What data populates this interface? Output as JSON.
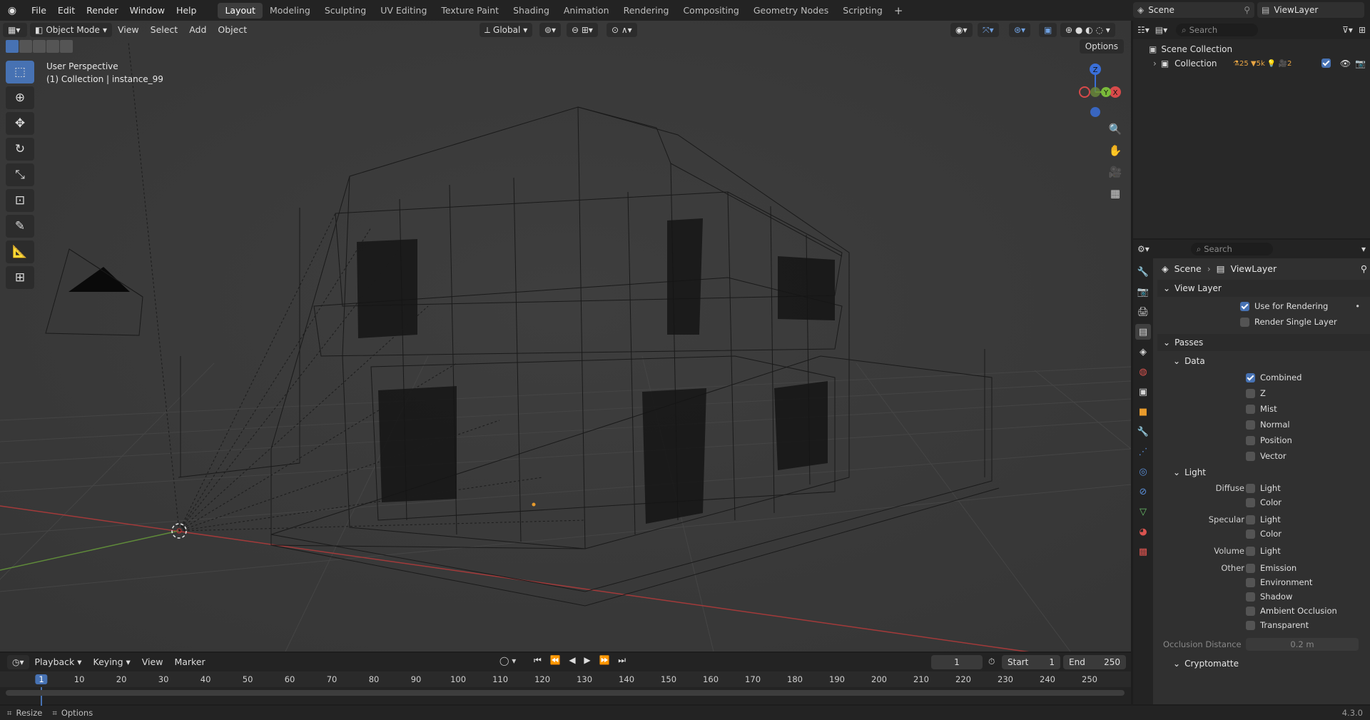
{
  "menubar": {
    "items": [
      "File",
      "Edit",
      "Render",
      "Window",
      "Help"
    ],
    "workspaces": [
      "Layout",
      "Modeling",
      "Sculpting",
      "UV Editing",
      "Texture Paint",
      "Shading",
      "Animation",
      "Rendering",
      "Compositing",
      "Geometry Nodes",
      "Scripting"
    ],
    "active_workspace": "Layout",
    "scene_name": "Scene",
    "view_layer_name": "ViewLayer"
  },
  "viewport": {
    "mode": "Object Mode",
    "menus": [
      "View",
      "Select",
      "Add",
      "Object"
    ],
    "transform_orientation": "Global",
    "options_label": "Options",
    "info_line1": "User Perspective",
    "info_line2": "(1) Collection | instance_99",
    "gizmo": {
      "z": "Z",
      "y": "Y",
      "x": "X"
    }
  },
  "outliner": {
    "search_placeholder": "Search",
    "scene_collection": "Scene Collection",
    "collection": "Collection",
    "collection_badges": [
      "25",
      "5k",
      "2"
    ]
  },
  "properties": {
    "search_placeholder": "Search",
    "breadcrumb_scene": "Scene",
    "breadcrumb_viewlayer": "ViewLayer",
    "view_layer_panel": "View Layer",
    "use_for_rendering": "Use for Rendering",
    "render_single_layer": "Render Single Layer",
    "passes_panel": "Passes",
    "data_sub": "Data",
    "data_passes": [
      {
        "label": "Combined",
        "on": true
      },
      {
        "label": "Z",
        "on": false
      },
      {
        "label": "Mist",
        "on": false
      },
      {
        "label": "Normal",
        "on": false
      },
      {
        "label": "Position",
        "on": false
      },
      {
        "label": "Vector",
        "on": false
      }
    ],
    "light_sub": "Light",
    "diffuse_label": "Diffuse",
    "specular_label": "Specular",
    "volume_label": "Volume",
    "other_label": "Other",
    "light_pass_light": "Light",
    "light_pass_color": "Color",
    "other_passes": [
      "Emission",
      "Environment",
      "Shadow",
      "Ambient Occlusion",
      "Transparent"
    ],
    "occlusion_distance_label": "Occlusion Distance",
    "occlusion_distance_value": "0.2 m",
    "cryptomatte_sub": "Cryptomatte"
  },
  "timeline": {
    "menus": [
      "Playback",
      "Keying",
      "View",
      "Marker"
    ],
    "current_frame": "1",
    "start_label": "Start",
    "start_value": "1",
    "end_label": "End",
    "end_value": "250",
    "ticks": [
      "1",
      "10",
      "20",
      "30",
      "40",
      "50",
      "60",
      "70",
      "80",
      "90",
      "100",
      "110",
      "120",
      "130",
      "140",
      "150",
      "160",
      "170",
      "180",
      "190",
      "200",
      "210",
      "220",
      "230",
      "240",
      "250"
    ]
  },
  "statusbar": {
    "resize": "Resize",
    "options": "Options",
    "version": "4.3.0"
  }
}
